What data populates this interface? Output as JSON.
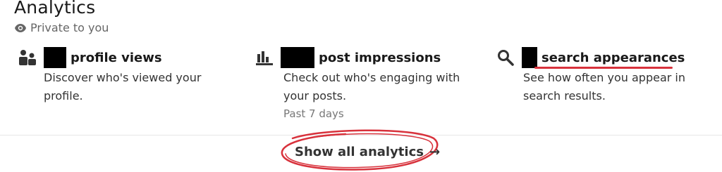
{
  "header": {
    "title": "Analytics",
    "visibility": "Private to you"
  },
  "metrics": [
    {
      "label": "profile views",
      "description": "Discover who's viewed your profile.",
      "icon": "people-icon"
    },
    {
      "label": "post impressions",
      "description": "Check out who's engaging with your posts.",
      "period": "Past 7 days",
      "icon": "bar-chart-icon"
    },
    {
      "label": "search appearances",
      "description": "See how often you appear in search results.",
      "icon": "search-icon"
    }
  ],
  "footer": {
    "show_all_label": "Show all analytics",
    "arrow": "→"
  },
  "colors": {
    "annotation": "#d8323c",
    "redaction": "#000000"
  }
}
